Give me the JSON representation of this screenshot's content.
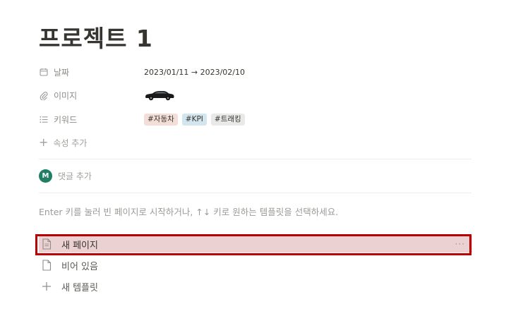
{
  "page": {
    "title": "프로젝트 1"
  },
  "properties": [
    {
      "name": "날짜",
      "icon": "calendar-icon",
      "value": "2023/01/11 → 2023/02/10"
    },
    {
      "name": "이미지",
      "icon": "paperclip-icon",
      "value_icon": "car-image"
    },
    {
      "name": "키워드",
      "icon": "list-icon",
      "tags": [
        {
          "label": "#자동차",
          "color": "#f4dfd8"
        },
        {
          "label": "#KPI",
          "color": "#d3e5ef"
        },
        {
          "label": "#트래킹",
          "color": "#e9e9e7"
        }
      ]
    }
  ],
  "add_property_label": "속성 추가",
  "comment": {
    "avatar_initial": "M",
    "avatar_color": "#1f7e64",
    "placeholder": "댓글 추가"
  },
  "hint": "Enter 키를 눌러 빈 페이지로 시작하거나, ↑↓ 키로 원하는 템플릿을 선택하세요.",
  "templates": [
    {
      "label": "새 페이지",
      "icon": "document-icon",
      "selected": true
    },
    {
      "label": "비어 있음",
      "icon": "document-icon",
      "selected": false
    },
    {
      "label": "새 템플릿",
      "icon": "plus-icon",
      "selected": false
    }
  ],
  "more_label": "···",
  "colors": {
    "text": "#37352f",
    "muted": "#9b9a97",
    "selected_bg": "#ebd1d1",
    "highlight_border": "#b80000"
  }
}
